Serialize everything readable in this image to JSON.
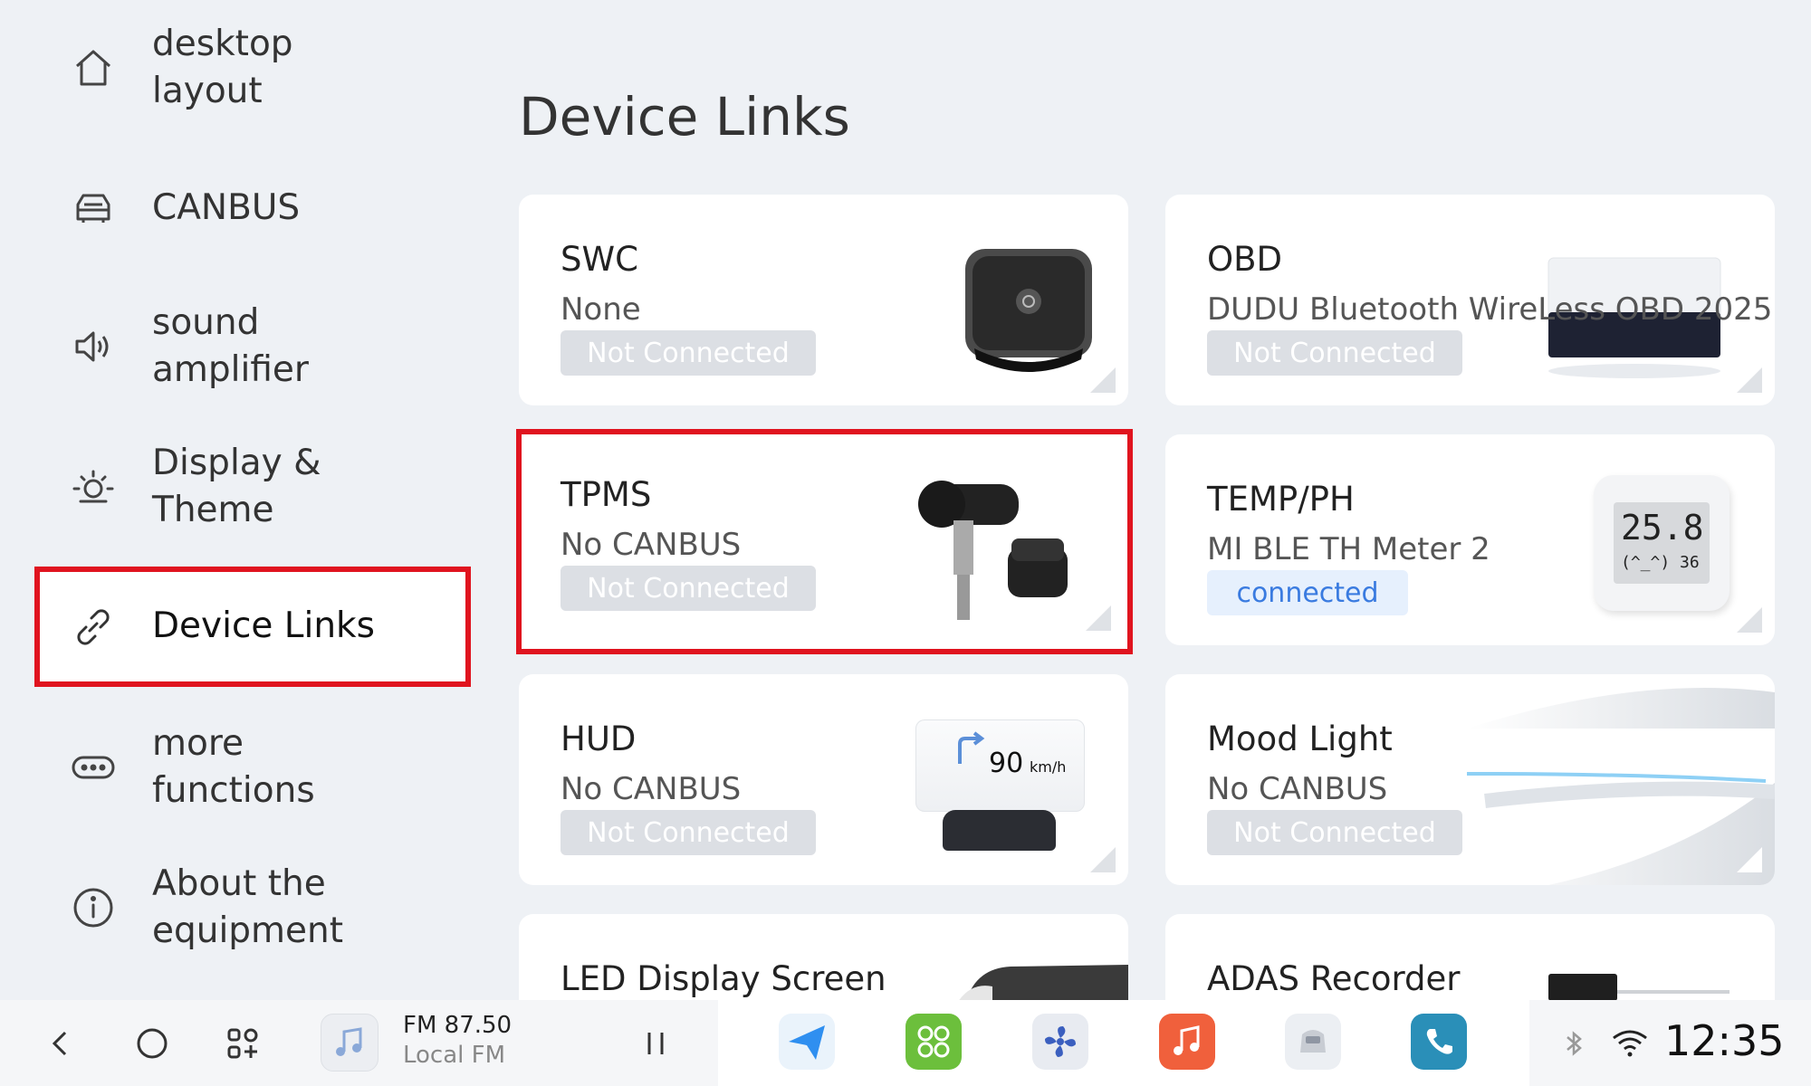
{
  "sidebar": {
    "items": [
      {
        "label": "desktop\nlayout",
        "icon": "home-icon"
      },
      {
        "label": "CANBUS",
        "icon": "car-icon"
      },
      {
        "label": "sound\namplifier",
        "icon": "speaker-icon"
      },
      {
        "label": "Display &\nTheme",
        "icon": "sun-icon"
      },
      {
        "label": "Device Links",
        "icon": "link-icon",
        "active": true
      },
      {
        "label": "more\nfunctions",
        "icon": "more-icon"
      },
      {
        "label": "About the\nequipment",
        "icon": "info-icon"
      }
    ]
  },
  "main": {
    "title": "Device Links",
    "cards": [
      {
        "title": "SWC",
        "subtitle": "None",
        "status": "Not Connected",
        "image": "steering-wheel-controller-icon"
      },
      {
        "title": "OBD",
        "subtitle": "DUDU Bluetooth WireLess OBD 2025",
        "status": "Not Connected",
        "image": "obd-adapter-icon"
      },
      {
        "title": "TPMS",
        "subtitle": "No CANBUS",
        "status": "Not Connected",
        "image": "tire-sensor-icon"
      },
      {
        "title": "TEMP/PH",
        "subtitle": "MI BLE TH Meter 2",
        "status": "connected",
        "image": "thermometer-display-icon",
        "display_temp": "25.8",
        "display_hum": "(^_^) 36"
      },
      {
        "title": "HUD",
        "subtitle": "No CANBUS",
        "status": "Not Connected",
        "image": "hud-display-icon",
        "hud_speed": "90",
        "hud_unit": "km/h"
      },
      {
        "title": "Mood Light",
        "subtitle": "No CANBUS",
        "status": "Not Connected",
        "image": "ambient-light-icon"
      },
      {
        "title": "LED Display Screen",
        "image": "led-screen-icon"
      },
      {
        "title": "ADAS Recorder",
        "image": "dashcam-icon"
      }
    ]
  },
  "taskbar": {
    "fm_frequency": "FM 87.50",
    "fm_station": "Local FM",
    "clock": "12:35"
  },
  "colors": {
    "highlight": "#e0141f",
    "connected_text": "#3a7be0",
    "status_bg": "#dcdfe4"
  }
}
